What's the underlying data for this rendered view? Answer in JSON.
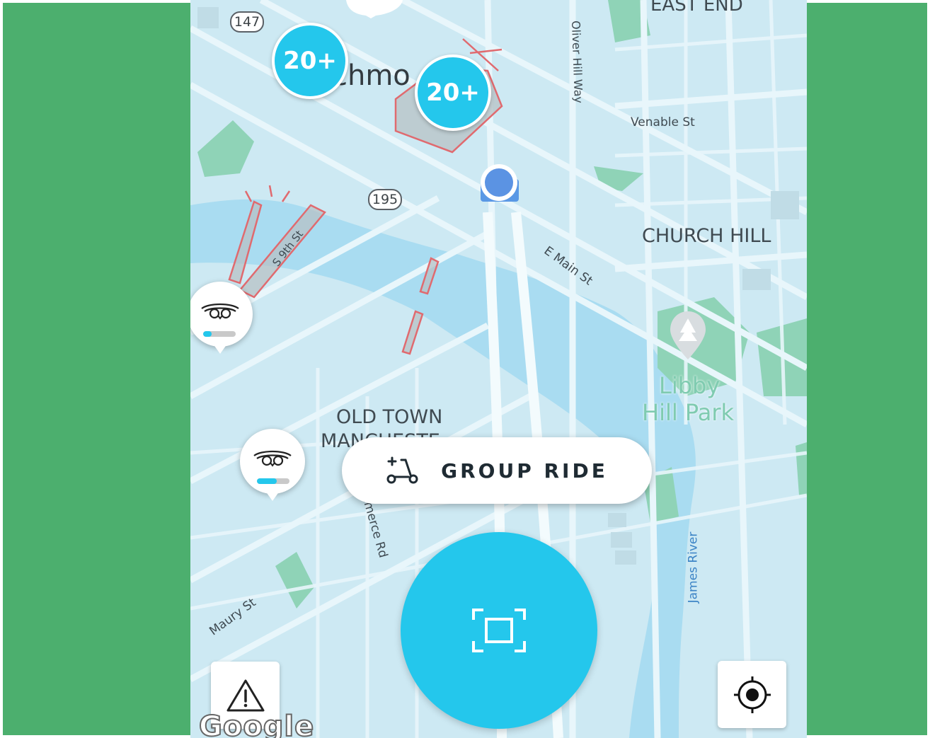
{
  "colors": {
    "outer": "#4caf6e",
    "accent": "#24c7ec",
    "water": "#a9dcf1",
    "land": "#cde9f3",
    "road": "#e7f5fa",
    "park": "#8fd3b7",
    "zone": "#e06a6f",
    "location": "#4d8fe3"
  },
  "map": {
    "clusters": [
      {
        "label": "20+"
      },
      {
        "label": "20+"
      }
    ],
    "labels": {
      "richmond": "chmo",
      "east_end": "EAST END",
      "church_hill": "CHURCH HILL",
      "old_town_1": "OLD TOWN",
      "old_town_2": "MANCHESTER",
      "libby_1": "Libby",
      "libby_2": "Hill Park",
      "venable": "Venable St",
      "oliver_hill": "Oliver Hill Way",
      "e_main": "E Main St",
      "s9th": "S 9th St",
      "commerce": "Commerce Rd",
      "maury": "Maury St",
      "james_river": "James River"
    },
    "shields": {
      "route_147": "147",
      "route_195": "195"
    },
    "scooters": [
      {
        "battery": 0.25,
        "icon": "bird-logo-icon"
      },
      {
        "battery": 0.6,
        "icon": "bird-logo-icon"
      }
    ],
    "attribution": "Google"
  },
  "actions": {
    "group_ride": "GROUP RIDE",
    "group_ride_icon": "scooter-plus-icon",
    "scan_icon": "scan-frame-icon",
    "report_icon": "warning-triangle-icon",
    "locate_icon": "crosshair-icon"
  }
}
